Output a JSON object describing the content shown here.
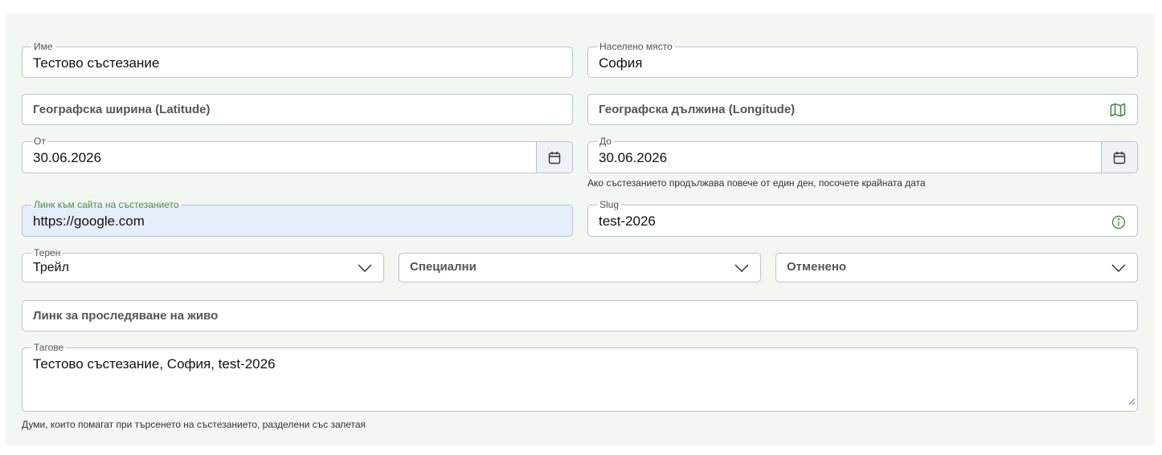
{
  "form": {
    "name": {
      "label": "Име",
      "value": "Тестово състезание"
    },
    "city": {
      "label": "Населено място",
      "value": "София"
    },
    "latitude": {
      "placeholder": "Географска ширина (Latitude)"
    },
    "longitude": {
      "placeholder": "Географска дължина (Longitude)",
      "icon": "map-icon"
    },
    "date_from": {
      "label": "От",
      "value": "30.06.2026",
      "icon": "calendar-icon"
    },
    "date_to": {
      "label": "До",
      "value": "30.06.2026",
      "icon": "calendar-icon",
      "helper": "Ако състезанието продължава повече от един ден, посочете крайната дата"
    },
    "website": {
      "label": "Линк към сайта на състезанието",
      "value": "https://google.com"
    },
    "slug": {
      "label": "Slug",
      "value": "test-2026",
      "icon": "info-icon"
    },
    "terrain": {
      "label": "Терен",
      "value": "Трейл",
      "icon": "chevron-down-icon"
    },
    "special": {
      "placeholder": "Специални",
      "icon": "chevron-down-icon"
    },
    "status": {
      "placeholder": "Отменено",
      "icon": "chevron-down-icon"
    },
    "live_tracking": {
      "placeholder": "Линк за проследяване на живо"
    },
    "tags": {
      "label": "Тагове",
      "value": "Тестово състезание, София, test-2026",
      "helper": "Думи, които помагат при търсенето на състезанието, разделени със запетая"
    }
  },
  "colors": {
    "panel_bg": "#f3f7f1",
    "border": "#b9c3d3",
    "accent_green": "#4d8a4b",
    "focused_bg": "#e6eefc"
  }
}
